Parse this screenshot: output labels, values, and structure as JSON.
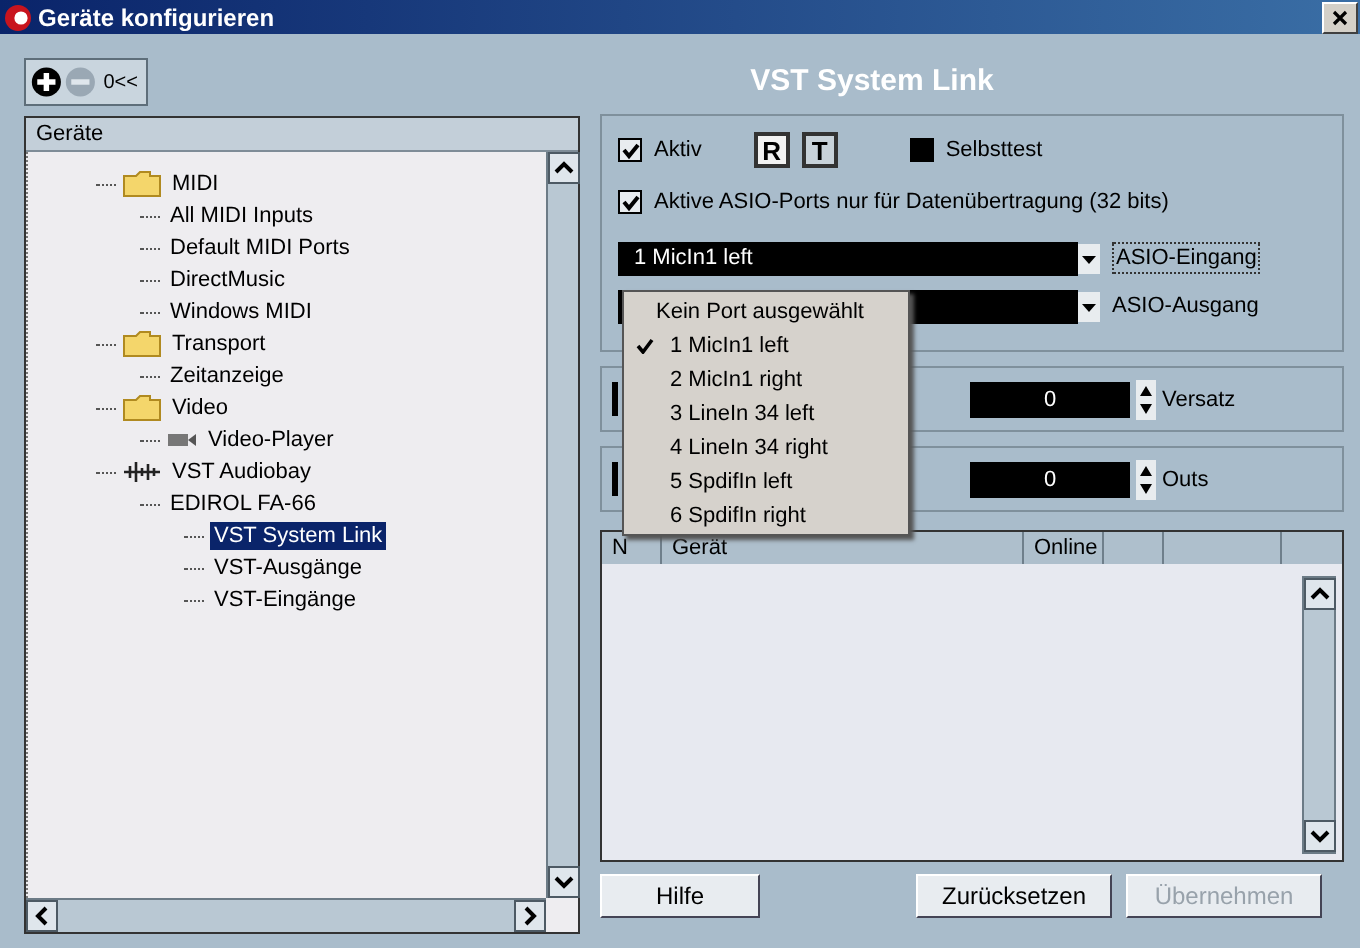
{
  "window": {
    "title": "Geräte konfigurieren"
  },
  "toolbar": {
    "add": {
      "disabled": false
    },
    "remove": {
      "disabled": true
    },
    "reset_label": "0<<"
  },
  "tree": {
    "header": "Geräte",
    "items": [
      {
        "label": "MIDI",
        "kind": "folder",
        "selected": false,
        "children": [
          {
            "label": "All MIDI Inputs",
            "selected": false
          },
          {
            "label": "Default MIDI Ports",
            "selected": false
          },
          {
            "label": "DirectMusic",
            "selected": false
          },
          {
            "label": "Windows MIDI",
            "selected": false
          }
        ]
      },
      {
        "label": "Transport",
        "kind": "folder",
        "selected": false,
        "children": [
          {
            "label": "Zeitanzeige",
            "selected": false
          }
        ]
      },
      {
        "label": "Video",
        "kind": "folder",
        "selected": false,
        "children": [
          {
            "label": "Video-Player",
            "kind": "video",
            "selected": false
          }
        ]
      },
      {
        "label": "VST Audiobay",
        "kind": "audio",
        "selected": false,
        "children": [
          {
            "label": "EDIROL FA-66",
            "selected": false,
            "children": [
              {
                "label": "VST System Link",
                "selected": true
              },
              {
                "label": "VST-Ausgänge",
                "selected": false
              },
              {
                "label": "VST-Eingänge",
                "selected": false
              }
            ]
          }
        ]
      }
    ]
  },
  "panel": {
    "title": "VST System Link",
    "aktiv": {
      "label": "Aktiv",
      "checked": true
    },
    "toggles": [
      {
        "label": "R",
        "selected": true
      },
      {
        "label": "T",
        "selected": false
      }
    ],
    "selbsttest": {
      "label": "Selbsttest",
      "checked": false
    },
    "asio_ports": {
      "label": "Aktive ASIO-Ports nur für Datenübertragung (32 bits)",
      "checked": true
    },
    "asio_input": {
      "value": "1 MicIn1 left",
      "label": "ASIO-Eingang"
    },
    "asio_output": {
      "label": "ASIO-Ausgang"
    },
    "dropdown_menu": [
      {
        "label": "Kein Port ausgewählt",
        "selected": false
      },
      {
        "label": "1 MicIn1 left",
        "selected": true
      },
      {
        "label": "2 MicIn1 right",
        "selected": false
      },
      {
        "label": "3 LineIn 34 left",
        "selected": false
      },
      {
        "label": "4 LineIn 34 right",
        "selected": false
      },
      {
        "label": "5 SpdifIn left",
        "selected": false
      },
      {
        "label": "6 SpdifIn right",
        "selected": false
      }
    ],
    "spinners": [
      {
        "value": "0",
        "label": "Versatz"
      },
      {
        "value": "0",
        "label": "Outs"
      }
    ],
    "table": {
      "columns": [
        "N",
        "Gerät",
        "Online",
        "",
        ""
      ]
    },
    "buttons": [
      {
        "label": "Hilfe",
        "disabled": false
      },
      {
        "label": "Zurücksetzen",
        "disabled": false
      },
      {
        "label": "Übernehmen",
        "disabled": true
      }
    ]
  }
}
